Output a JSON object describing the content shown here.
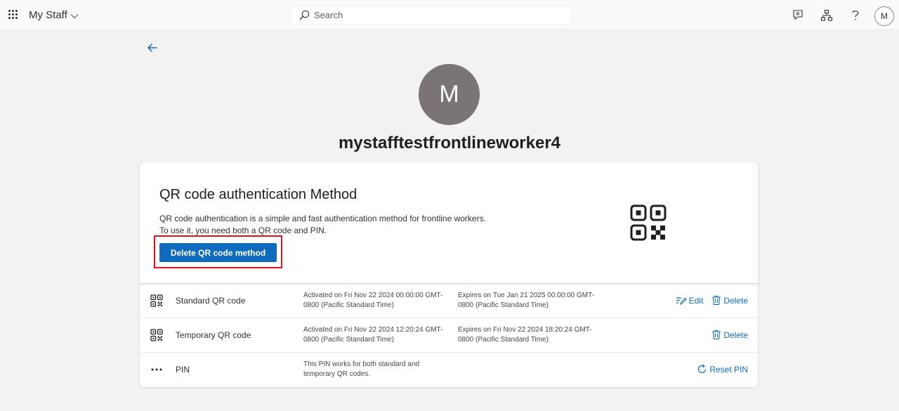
{
  "header": {
    "app_title": "My Staff",
    "search_placeholder": "Search",
    "user_initial": "M"
  },
  "profile": {
    "initial": "M",
    "username": "mystafftestfrontlineworker4"
  },
  "card": {
    "title": "QR code authentication Method",
    "description_line1": "QR code authentication is a simple and fast authentication method for frontline workers.",
    "description_line2": "To use it, you need both a QR code and PIN.",
    "delete_button": "Delete QR code method"
  },
  "rows": [
    {
      "name": "Standard QR code",
      "col1": "Activated on Fri Nov 22 2024 00:00:00 GMT-0800 (Pacific Standard Time)",
      "col2": "Expires on Tue Jan 21 2025 00:00:00 GMT-0800 (Pacific Standard Time)",
      "edit_label": "Edit",
      "delete_label": "Delete"
    },
    {
      "name": "Temporary QR code",
      "col1": "Activated on Fri Nov 22 2024 12:20:24 GMT-0800 (Pacific Standard Time)",
      "col2": "Expires on Fri Nov 22 2024 18:20:24 GMT-0800 (Pacific Standard Time)",
      "delete_label": "Delete"
    },
    {
      "name": "PIN",
      "col1": "This PIN works for both standard and temporary QR codes.",
      "reset_label": "Reset PIN"
    }
  ],
  "colors": {
    "accent": "#0f6cbd",
    "highlight": "#e3101a",
    "avatar_bg": "#7a7574",
    "page_bg": "#f3f2f1"
  }
}
